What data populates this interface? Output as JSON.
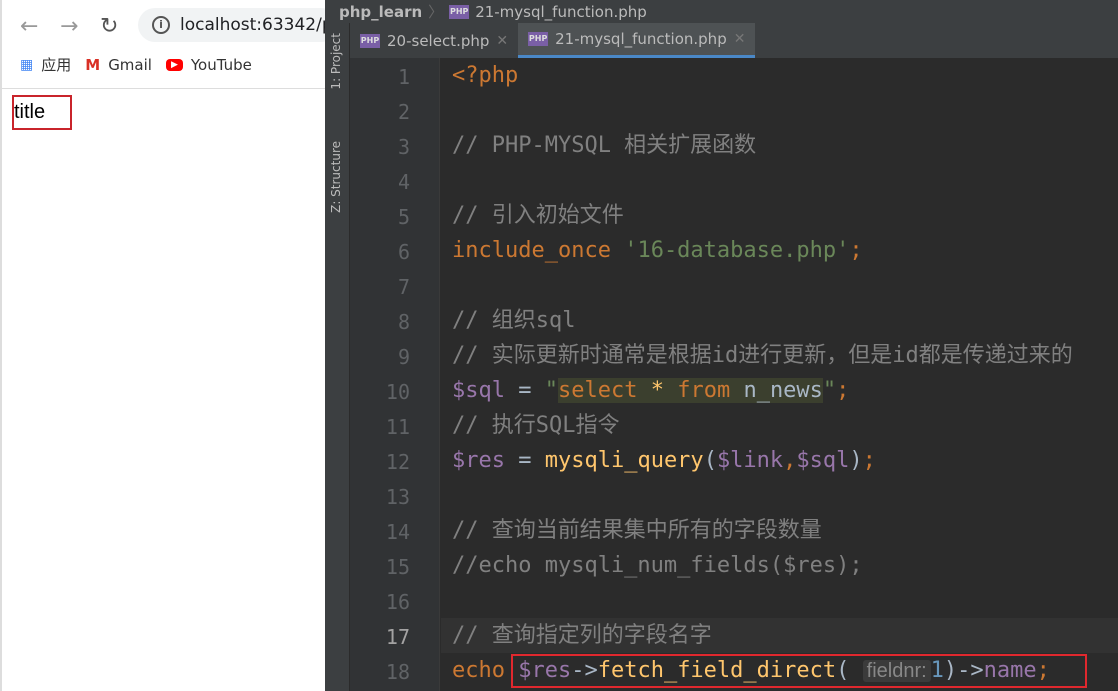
{
  "browser": {
    "url": "localhost:63342/p",
    "bookmarks": [
      {
        "label": "应用",
        "icon": "apps-grid-icon"
      },
      {
        "label": "Gmail",
        "icon": "gmail-icon"
      },
      {
        "label": "YouTube",
        "icon": "youtube-icon"
      }
    ],
    "page_text": "title"
  },
  "ide": {
    "breadcrumb": {
      "project": "php_learn",
      "file": "21-mysql_function.php"
    },
    "side_tools": [
      "1: Project",
      "Z: Structure"
    ],
    "tabs": [
      {
        "label": "20-select.php",
        "active": false
      },
      {
        "label": "21-mysql_function.php",
        "active": true
      }
    ],
    "current_line": 17,
    "line_numbers": [
      "1",
      "2",
      "3",
      "4",
      "5",
      "6",
      "7",
      "8",
      "9",
      "10",
      "11",
      "12",
      "13",
      "14",
      "15",
      "16",
      "17",
      "18"
    ],
    "code": {
      "l1": "<?php",
      "l3": "// PHP-MYSQL 相关扩展函数",
      "l5": "// 引入初始文件",
      "l6_kw": "include_once",
      "l6_str": "'16-database.php'",
      "l8": "// 组织sql",
      "l9": "// 实际更新时通常是根据id进行更新，但是id都是传递过来的",
      "l10_var": "$sql",
      "l10_sql_select": "select",
      "l10_sql_star": " * ",
      "l10_sql_from": "from",
      "l10_sql_table": " n_news",
      "l11": "// 执行SQL指令",
      "l12_var": "$res",
      "l12_fn": "mysqli_query",
      "l12_a1": "$link",
      "l12_a2": "$sql",
      "l14": "// 查询当前结果集中所有的字段数量",
      "l15": "//echo mysqli_num_fields($res);",
      "l17": "// 查询指定列的字段名字",
      "l18_kw": "echo",
      "l18_var": "$res",
      "l18_fn": "fetch_field_direct",
      "l18_hint": "fieldnr:",
      "l18_num": "1",
      "l18_prop": "name"
    }
  }
}
